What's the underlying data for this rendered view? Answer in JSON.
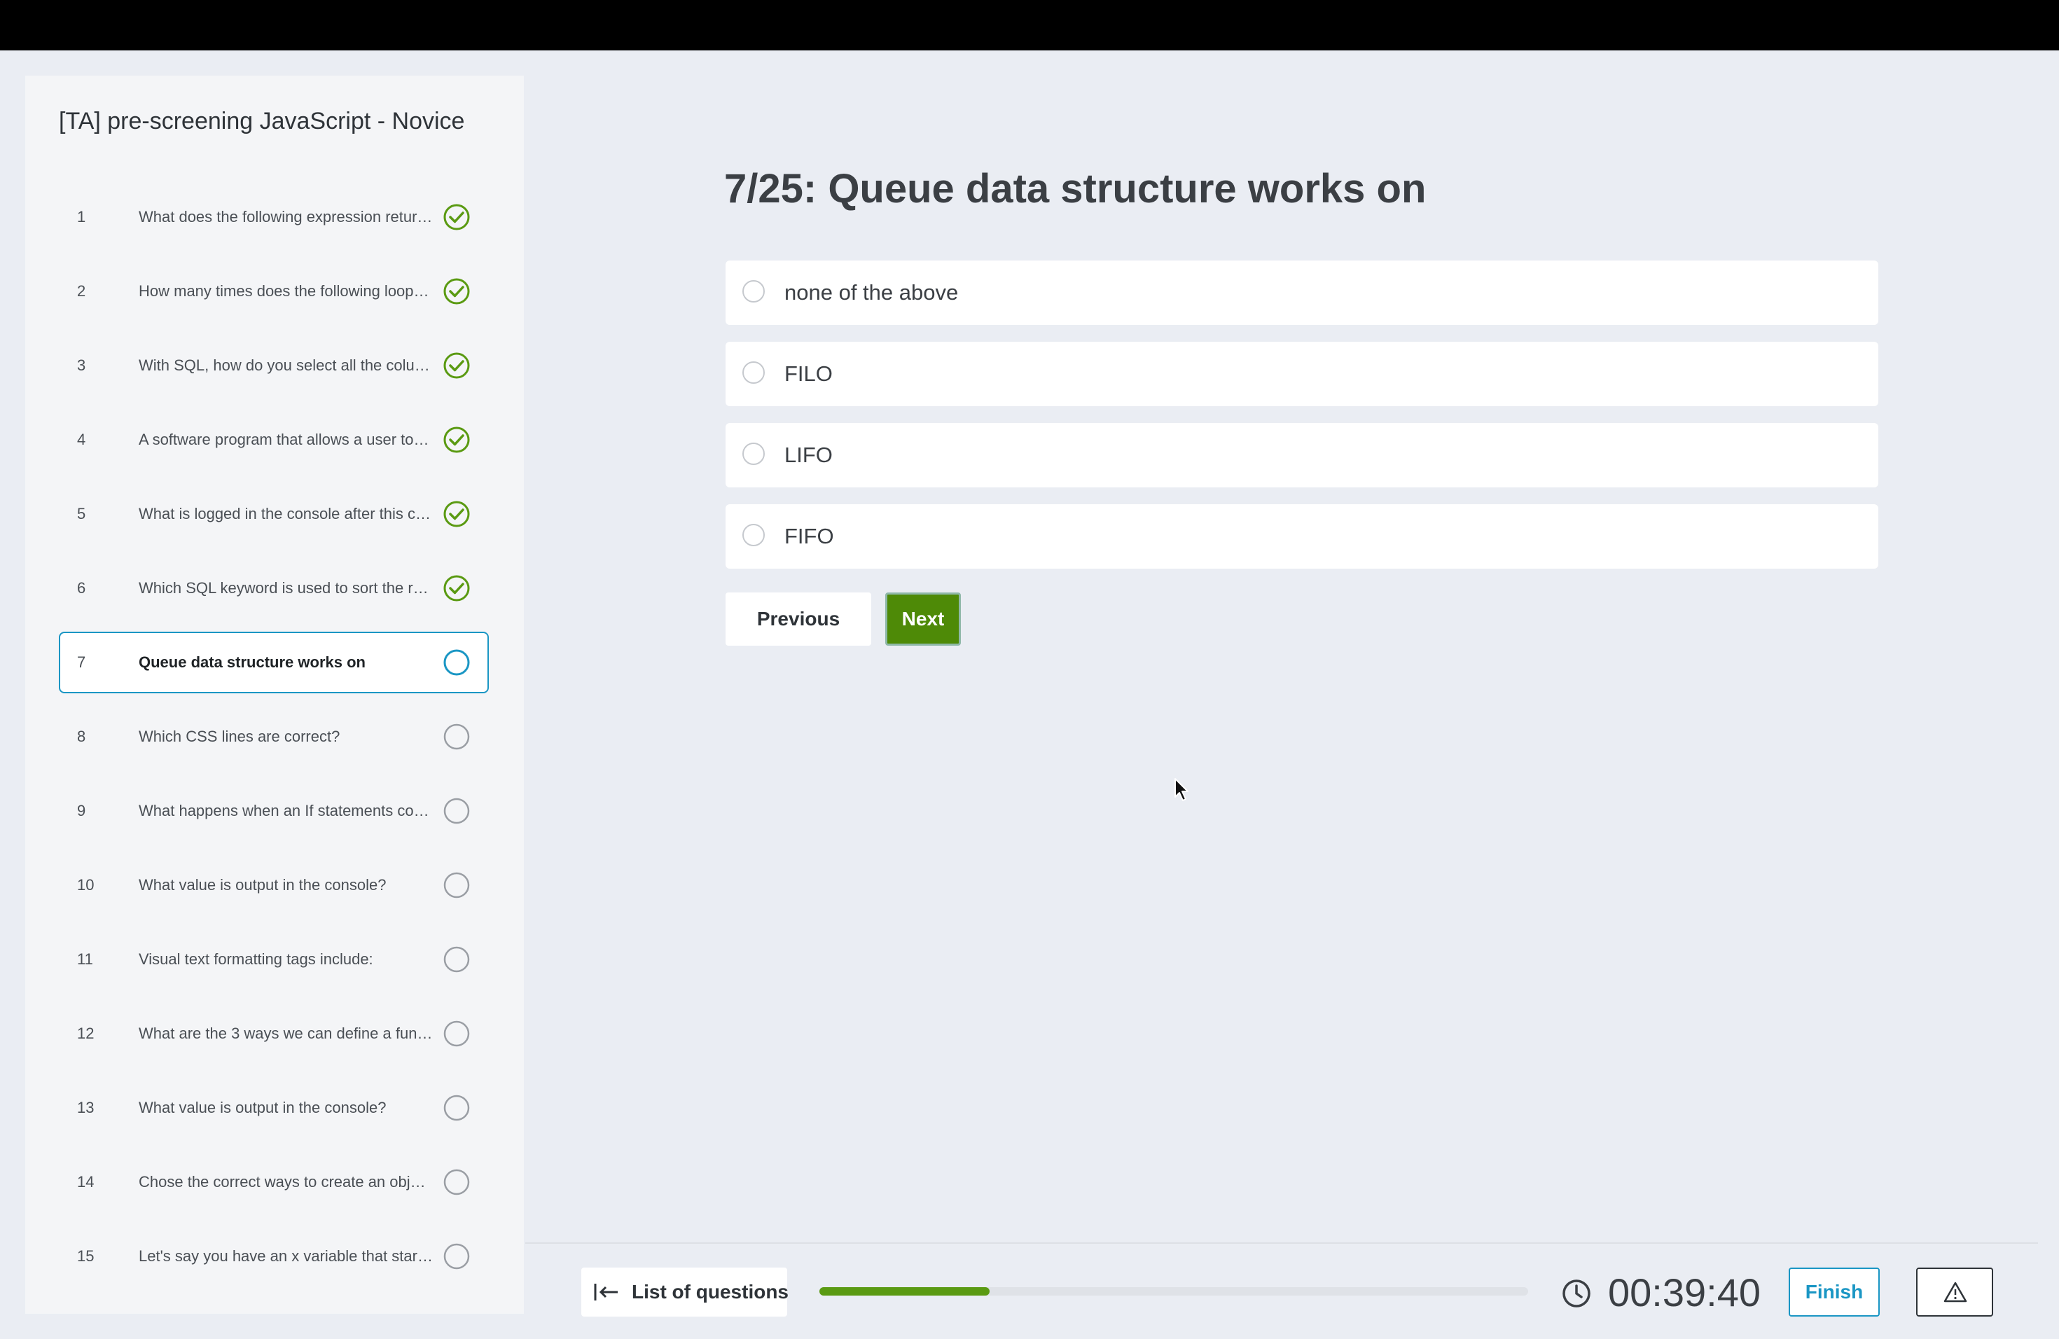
{
  "test": {
    "title": "[TA] pre-screening JavaScript - Novice"
  },
  "questions": [
    {
      "num": "1",
      "text": "What does the following expression retur…",
      "status": "answered"
    },
    {
      "num": "2",
      "text": "How many times does the following loop…",
      "status": "answered"
    },
    {
      "num": "3",
      "text": "With SQL, how do you select all the colu…",
      "status": "answered"
    },
    {
      "num": "4",
      "text": "A software program that allows a user to …",
      "status": "answered"
    },
    {
      "num": "5",
      "text": "What is logged in the console after this c…",
      "status": "answered"
    },
    {
      "num": "6",
      "text": "Which SQL keyword is used to sort the re…",
      "status": "answered"
    },
    {
      "num": "7",
      "text": "Queue data structure works on",
      "status": "current"
    },
    {
      "num": "8",
      "text": "Which CSS lines are correct?",
      "status": "unanswered"
    },
    {
      "num": "9",
      "text": "What happens when an If statements con…",
      "status": "unanswered"
    },
    {
      "num": "10",
      "text": "What value is output in the console?",
      "status": "unanswered"
    },
    {
      "num": "11",
      "text": "Visual text formatting tags include:",
      "status": "unanswered"
    },
    {
      "num": "12",
      "text": "What are the 3 ways we can define a func…",
      "status": "unanswered"
    },
    {
      "num": "13",
      "text": "What value is output in the console?",
      "status": "unanswered"
    },
    {
      "num": "14",
      "text": "Chose the correct ways to create an obje…",
      "status": "unanswered"
    },
    {
      "num": "15",
      "text": "Let's say you have an x variable that star…",
      "status": "unanswered"
    }
  ],
  "current_question": {
    "title": "7/25: Queue data structure works on",
    "options": [
      "none of the above",
      "FILO",
      "LIFO",
      "FIFO"
    ]
  },
  "nav": {
    "previous_label": "Previous",
    "next_label": "Next"
  },
  "footer": {
    "list_label": "List of questions",
    "progress_fraction": 0.24,
    "timer": "00:39:40",
    "finish_label": "Finish"
  },
  "colors": {
    "answered": "#5a9a12",
    "current": "#1a96c4",
    "unanswered": "#9a9ea4",
    "next_button": "#4e8a07"
  },
  "icons": {
    "answered": "check-circle-icon",
    "current": "circle-outline-icon",
    "unanswered": "circle-outline-icon",
    "list": "collapse-left-icon",
    "timer": "clock-icon",
    "report": "warning-triangle-icon"
  }
}
